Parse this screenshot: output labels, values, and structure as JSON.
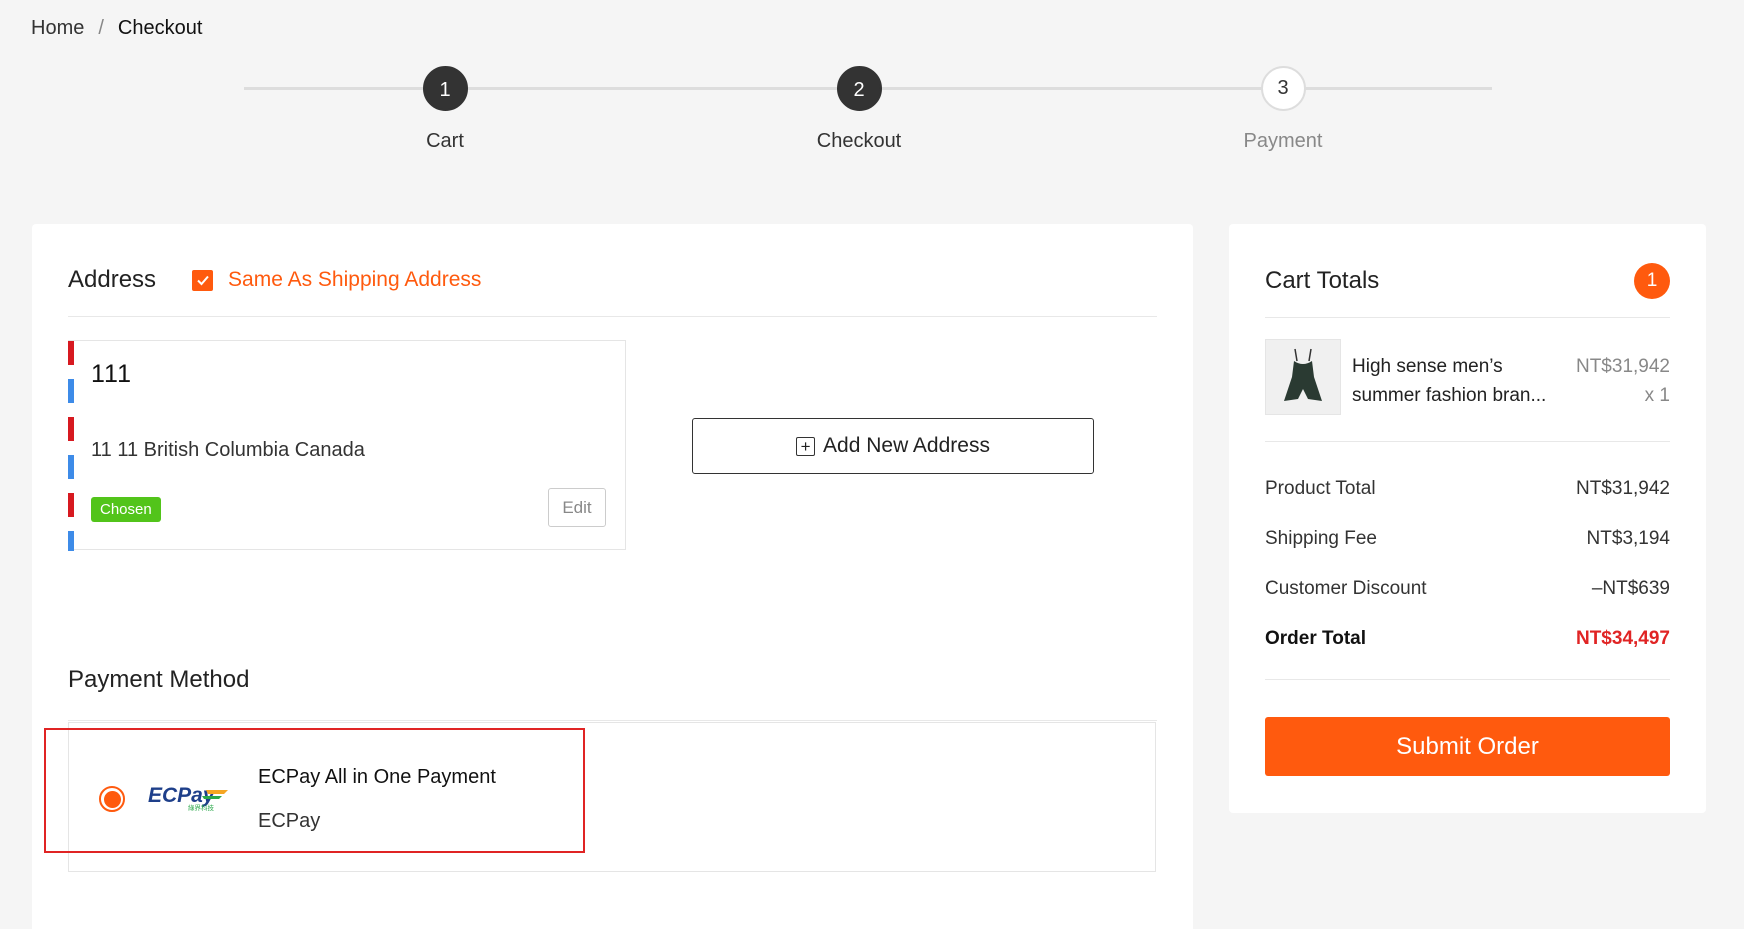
{
  "breadcrumb": {
    "home": "Home",
    "separator": "/",
    "current": "Checkout"
  },
  "steps": [
    {
      "number": "1",
      "label": "Cart",
      "status": "done"
    },
    {
      "number": "2",
      "label": "Checkout",
      "status": "active"
    },
    {
      "number": "3",
      "label": "Payment",
      "status": "pending"
    }
  ],
  "address": {
    "title": "Address",
    "same_as_shipping": "Same As Shipping Address",
    "same_as_shipping_checked": true,
    "card": {
      "name": "111",
      "line": "11 11 British Columbia Canada",
      "badge": "Chosen",
      "edit_label": "Edit"
    },
    "add_new_label": "Add New Address",
    "add_icon": "plus-square-icon"
  },
  "payment": {
    "title": "Payment Method",
    "option": {
      "name": "ECPay All in One Payment",
      "provider": "ECPay",
      "logo_text": "ECPay",
      "logo_subtext": "綠界科技",
      "selected": true
    }
  },
  "cart": {
    "title": "Cart Totals",
    "count": "1",
    "item": {
      "name_line1": "High sense men’s",
      "name_line2": "summer fashion bran...",
      "price": "NT$31,942",
      "qty": "x 1"
    },
    "totals": [
      {
        "label": "Product Total",
        "value": "NT$31,942"
      },
      {
        "label": "Shipping Fee",
        "value": "NT$3,194"
      },
      {
        "label": "Customer Discount",
        "value": "–NT$639"
      }
    ],
    "order_total": {
      "label": "Order Total",
      "value": "NT$34,497"
    },
    "submit_label": "Submit Order"
  },
  "colors": {
    "accent": "#ff5a0e",
    "danger": "#e02424",
    "chosen": "#52c41a",
    "step_active": "#333333"
  }
}
